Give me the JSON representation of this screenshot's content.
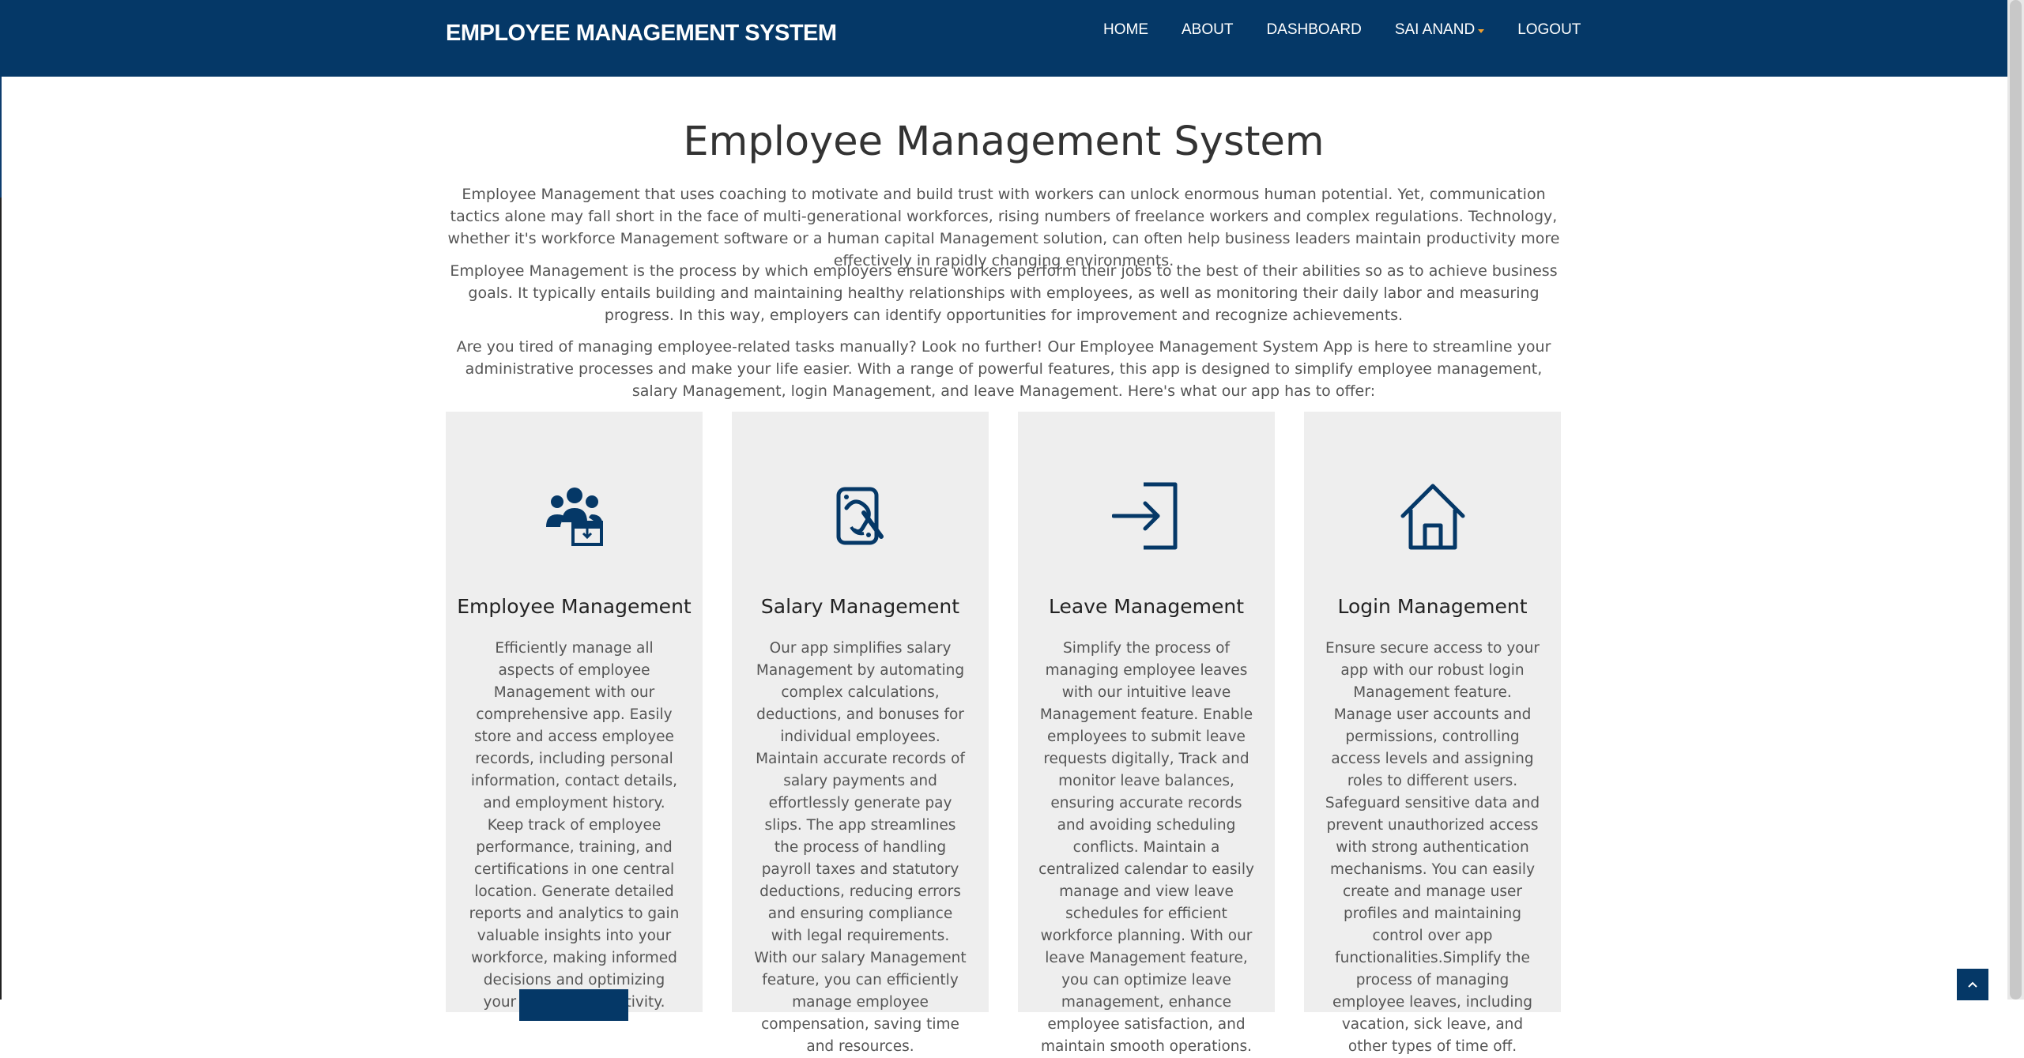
{
  "navbar": {
    "brand": "EMPLOYEE MANAGEMENT SYSTEM",
    "items": [
      {
        "label": "HOME"
      },
      {
        "label": "ABOUT"
      },
      {
        "label": "DASHBOARD"
      },
      {
        "label": "SAI ANAND"
      },
      {
        "label": "LOGOUT"
      }
    ]
  },
  "colors": {
    "primary": "#053867",
    "card_bg": "#eeeeee",
    "caret": "#f0a030"
  },
  "main": {
    "title": "Employee Management System",
    "paragraphs": [
      "Employee Management that uses coaching to motivate and build trust with workers can unlock enormous human potential. Yet, communication tactics alone may fall short in the face of multi-generational workforces, rising numbers of freelance workers and complex regulations. Technology, whether it's workforce Management software or a human capital Management solution, can often help business leaders maintain productivity more effectively in rapidly changing environments.",
      "Employee Management is the process by which employers ensure workers perform their jobs to the best of their abilities so as to achieve business goals. It typically entails building and maintaining healthy relationships with employees, as well as monitoring their daily labor and measuring progress. In this way, employers can identify opportunities for improvement and recognize achievements.",
      "Are you tired of managing employee-related tasks manually? Look no further! Our Employee Management System App is here to streamline your administrative processes and make your life easier. With a range of powerful features, this app is designed to simplify employee management, salary Management, login Management, and leave Management. Here's what our app has to offer:"
    ]
  },
  "cards": [
    {
      "icon": "people-icon",
      "title": "Employee Management",
      "text": "Efficiently manage all aspects of employee Management with our comprehensive app. Easily store and access employee records, including personal information, contact details, and employment history. Keep track of employee performance, training, and certifications in one central location. Generate detailed reports and analytics to gain valuable insights into your workforce, making informed decisions and optimizing your team's productivity."
    },
    {
      "icon": "salary-icon",
      "title": "Salary Management",
      "text": "Our app simplifies salary Management by automating complex calculations, deductions, and bonuses for individual employees. Maintain accurate records of salary payments and effortlessly generate pay slips. The app streamlines the process of handling payroll taxes and statutory deductions, reducing errors and ensuring compliance with legal requirements. With our salary Management feature, you can efficiently manage employee compensation, saving time and resources."
    },
    {
      "icon": "sign-in-icon",
      "title": "Leave Management",
      "text": "Simplify the process of managing employee leaves with our intuitive leave Management feature. Enable employees to submit leave requests digitally, Track and monitor leave balances, ensuring accurate records and avoiding scheduling conflicts. Maintain a centralized calendar to easily manage and view leave schedules for efficient workforce planning. With our leave Management feature, you can optimize leave management, enhance employee satisfaction, and maintain smooth operations."
    },
    {
      "icon": "home-icon",
      "title": "Login Management",
      "text": "Ensure secure access to your app with our robust login Management feature. Manage user accounts and permissions, controlling access levels and assigning roles to different users. Safeguard sensitive data and prevent unauthorized access with strong authentication mechanisms. You can easily create and manage user profiles and maintaining control over app functionalities.Simplify the process of managing employee leaves, including vacation, sick leave, and other types of time off."
    }
  ]
}
